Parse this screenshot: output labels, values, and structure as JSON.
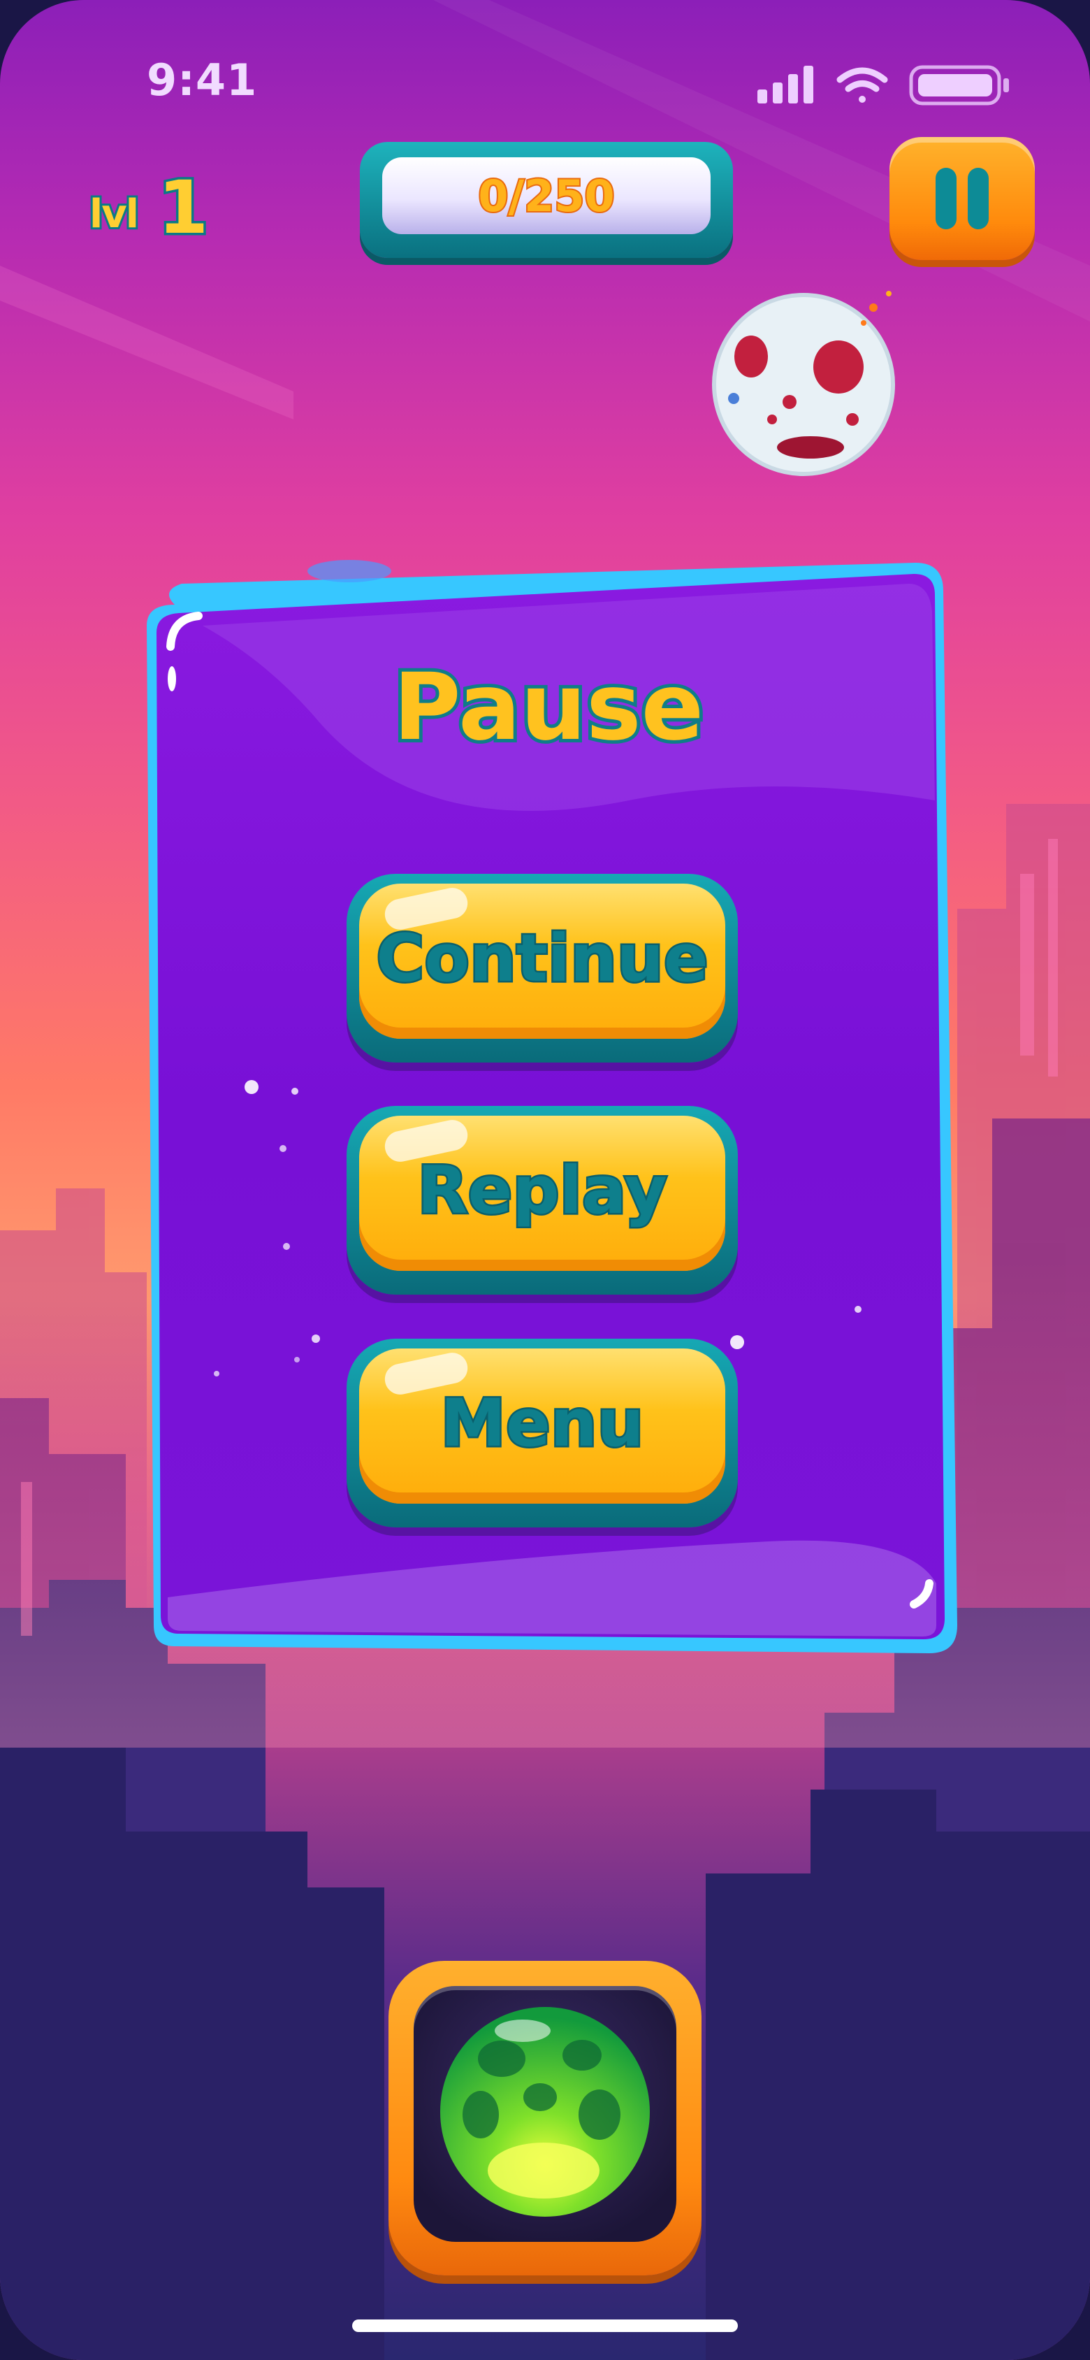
{
  "status_bar": {
    "time": "9:41",
    "icons": [
      "signal-icon",
      "wifi-icon",
      "battery-icon"
    ]
  },
  "hud": {
    "level_prefix": "lvl",
    "level_number": "1",
    "score": "0/250",
    "pause_icon": "pause-icon"
  },
  "pause_dialog": {
    "title": "Pause",
    "buttons": [
      {
        "id": "continue",
        "label": "Continue"
      },
      {
        "id": "replay",
        "label": "Replay"
      },
      {
        "id": "menu",
        "label": "Menu"
      }
    ]
  },
  "next_bubble": {
    "icon": "green-planet-bubble-icon"
  },
  "colors": {
    "dialog": "#7a12d6",
    "dialog_border": "#3fd6ff",
    "button_face": "#ffc21a",
    "button_text": "#0e7f8c",
    "title": "#ffc21f",
    "accent_orange": "#ff8a10"
  }
}
